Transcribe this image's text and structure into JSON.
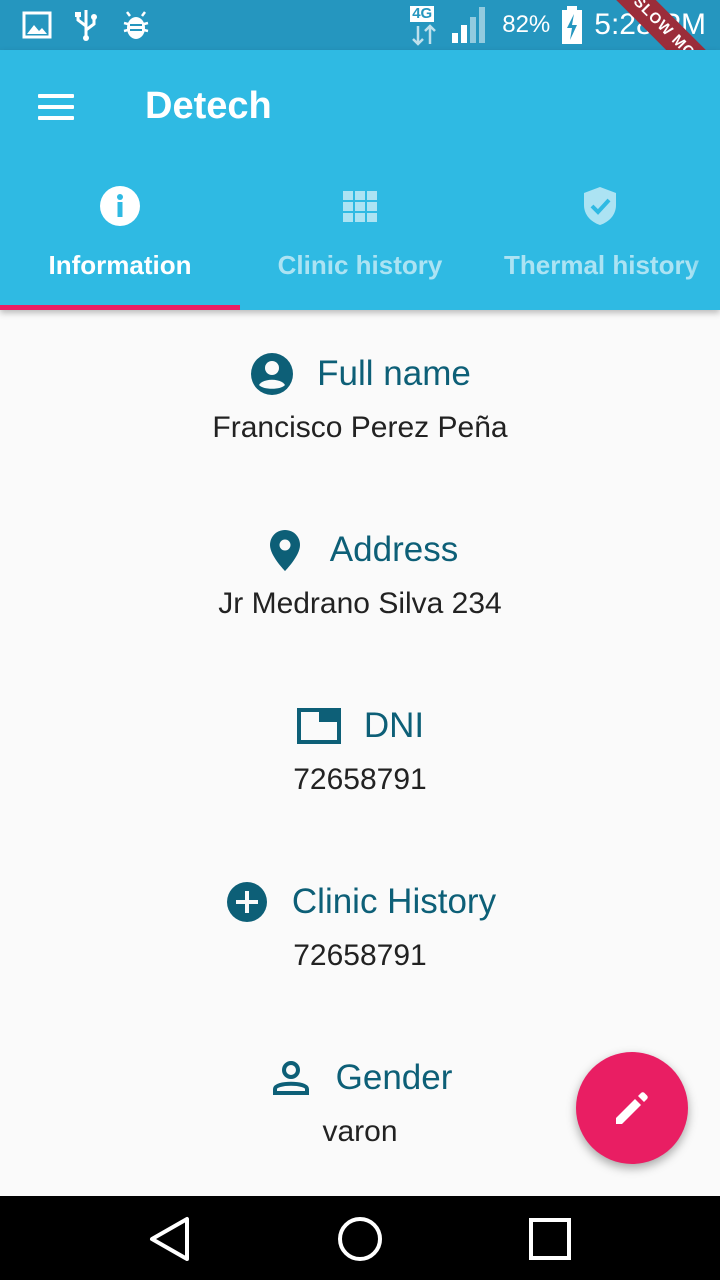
{
  "status_bar": {
    "network": "4G",
    "battery": "82%",
    "time": "5:28 PM",
    "slow_mode": "SLOW MODE"
  },
  "app_bar": {
    "title": "Detech",
    "color": "#2fbae3"
  },
  "tabs": [
    {
      "label": "Information",
      "icon": "info-icon",
      "selected": true
    },
    {
      "label": "Clinic history",
      "icon": "grid-icon",
      "selected": false
    },
    {
      "label": "Thermal history",
      "icon": "shield-check-icon",
      "selected": false
    }
  ],
  "fields": [
    {
      "label": "Full name",
      "value": "Francisco Perez Peña",
      "icon": "account-circle-icon"
    },
    {
      "label": "Address",
      "value": "Jr Medrano Silva 234",
      "icon": "location-pin-icon"
    },
    {
      "label": "DNI",
      "value": "72658791",
      "icon": "id-card-icon"
    },
    {
      "label": "Clinic History",
      "value": "72658791",
      "icon": "add-circle-icon"
    },
    {
      "label": "Gender",
      "value": "varon",
      "icon": "person-outline-icon"
    }
  ],
  "fab": {
    "icon": "edit-pencil-icon",
    "color": "#e91e63"
  },
  "accent_colors": {
    "label": "#0d5f77",
    "indicator": "#e91e63"
  }
}
